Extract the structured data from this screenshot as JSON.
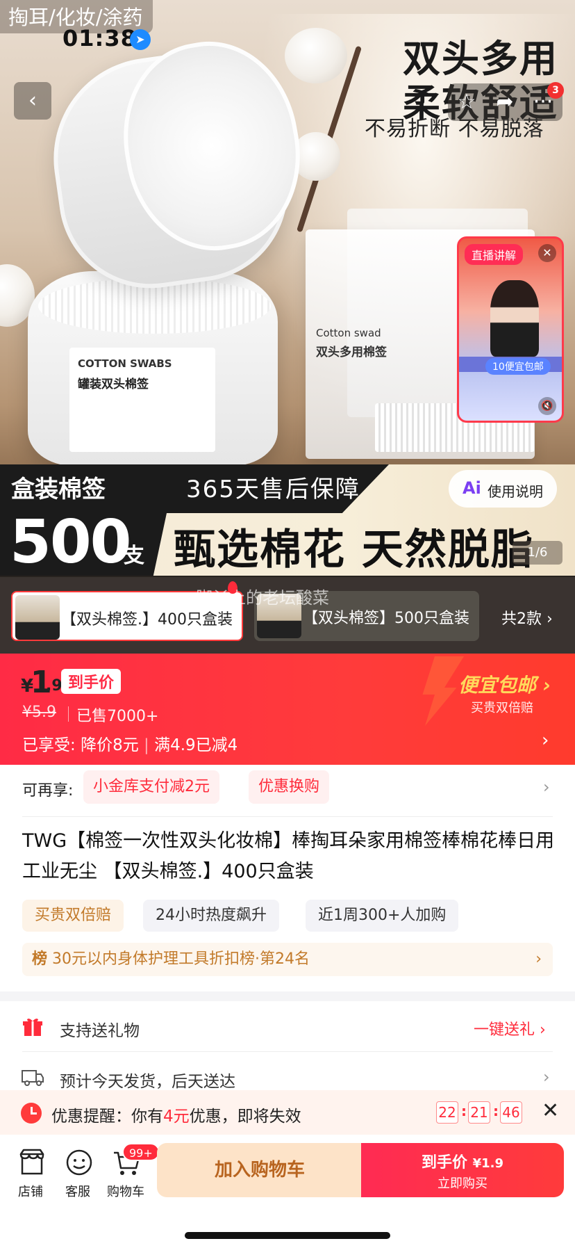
{
  "status": {
    "time": "01:38",
    "category": "掏耳/化妆/涂药"
  },
  "hero": {
    "slogan_line1": "双头多用",
    "slogan_line2": "柔软舒适",
    "slogan_line3": "不易折断 不易脱落",
    "jar_label_en": "COTTON SWABS",
    "jar_label_cn": "罐装双头棉签",
    "bag_label_en": "Cotton swad",
    "bag_label_cn": "双头多用棉签",
    "banner_tag": "盒装棉签",
    "banner_guarantee": "365天售后保障",
    "banner_count": "500",
    "banner_unit": "支",
    "banner_main": "甄选棉花 天然脱脂",
    "ai_button": "使用说明",
    "ai_icon": "Ai",
    "page_indicator": "1/6",
    "badge_count": "3",
    "live_tag": "直播讲解",
    "live_button": "10便宜包邮",
    "overlay_username": "脚丫上的老坛酸菜"
  },
  "variants": [
    {
      "label": "【双头棉签.】400只盒装",
      "selected": true
    },
    {
      "label": "【双头棉签】500只盒装",
      "selected": false
    }
  ],
  "variants_total": "共2款 ›",
  "price": {
    "currency": "¥",
    "int": "1",
    "dec": ".9",
    "tag": "到手价",
    "original": "¥5.9",
    "sold": "已售7000+",
    "enjoy_label": "已享受:",
    "enjoy_1": "降价8元",
    "enjoy_2": "满4.9已减4",
    "cheap_title": "便宜包邮 ›",
    "cheap_sub": "买贵双倍赔"
  },
  "reenjoy": {
    "label": "可再享:",
    "chips": [
      "小金库支付减2元",
      "优惠换购"
    ]
  },
  "title": "TWG【棉签一次性双头化妆棉】棒掏耳朵家用棉签棒棉花棒日用工业无尘 【双头棉签.】400只盒装",
  "tags": [
    "买贵双倍赔",
    "24小时热度飙升",
    "近1周300+人加购"
  ],
  "rank": {
    "icon": "榜",
    "text": "30元以内身体护理工具折扣榜·第24名"
  },
  "gift": {
    "text": "支持送礼物",
    "link": "一键送礼 ›"
  },
  "shipping": {
    "text": "预计今天发货，后天送达"
  },
  "reminder": {
    "prefix": "优惠提醒：你有",
    "amount": "4元",
    "suffix": "优惠，即将失效",
    "hh": "22",
    "mm": "21",
    "ss": "46"
  },
  "bar": {
    "shop": "店铺",
    "service": "客服",
    "cart": "购物车",
    "cart_badge": "99+",
    "add_cart": "加入购物车",
    "buy_line1": "到手价",
    "buy_price": "¥1.9",
    "buy_line2": "立即购买"
  },
  "colors": {
    "accent_red": "#ff2b45",
    "gold": "#c27a2a",
    "cheap_yellow": "#ffd95c"
  }
}
